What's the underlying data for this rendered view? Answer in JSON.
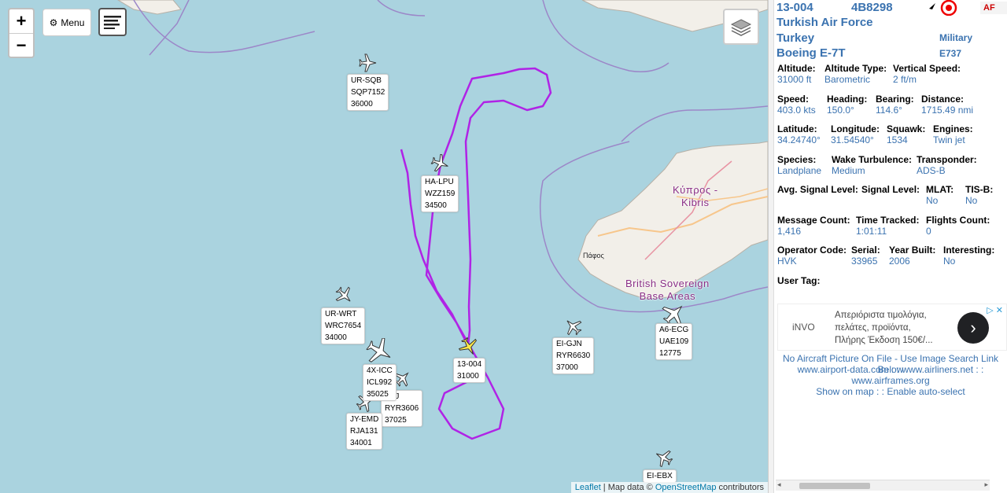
{
  "map": {
    "zoom_in": "+",
    "zoom_out": "−",
    "menu_label": "Menu",
    "land_labels": {
      "cyprus": "Κύπρος -\nKibris",
      "paphos": "Πάφος",
      "sovereign": "British Sovereign\nBase Areas"
    },
    "attribution": {
      "leaflet": "Leaflet",
      "sep": " | Map data © ",
      "osm": "OpenStreetMap",
      "tail": " contributors"
    },
    "aircraft": [
      {
        "name": "aircraft-ur-sqb",
        "label": "UR-SQB\nSQP7152\n36000"
      },
      {
        "name": "aircraft-ha-lpu",
        "label": "HA-LPU\nWZZ159\n34500"
      },
      {
        "name": "aircraft-ur-wrt",
        "label": "UR-WRT\nWRC7654\n34000"
      },
      {
        "name": "aircraft-4x-icc",
        "label": "4X-ICC\nICL992\n35025"
      },
      {
        "name": "aircraft-ssj",
        "label": "SSJ\nRYR3606\n37025"
      },
      {
        "name": "aircraft-jy-emd",
        "label": "JY-EMD\nRJA131\n34001"
      },
      {
        "name": "aircraft-13-004",
        "label": "13-004\n31000"
      },
      {
        "name": "aircraft-ei-gjn",
        "label": "EI-GJN\nRYR6630\n37000"
      },
      {
        "name": "aircraft-a6-ecg",
        "label": "A6-ECG\nUAE109\n12775"
      },
      {
        "name": "aircraft-ei-ebx",
        "label": "EI-EBX"
      }
    ]
  },
  "panel": {
    "callsign": "13-004",
    "icao": "4B8298",
    "flag_code": "AF",
    "operator": "Turkish Air Force",
    "country": "Turkey",
    "category": "Military",
    "type_name": "Boeing E-7T",
    "type_code": "E737",
    "fields": [
      {
        "label": "Altitude:",
        "value": "31000 ft"
      },
      {
        "label": "Altitude Type:",
        "value": "Barometric"
      },
      {
        "label": "Vertical Speed:",
        "value": "2 ft/m"
      },
      {
        "label": "Speed:",
        "value": "403.0 kts"
      },
      {
        "label": "Heading:",
        "value": "150.0°"
      },
      {
        "label": "Bearing:",
        "value": "114.6°"
      },
      {
        "label": "Distance:",
        "value": "1715.49 nmi"
      },
      {
        "label": "Latitude:",
        "value": "34.24740°"
      },
      {
        "label": "Longitude:",
        "value": "31.54540°"
      },
      {
        "label": "Squawk:",
        "value": "1534"
      },
      {
        "label": "Engines:",
        "value": "Twin jet"
      },
      {
        "label": "Species:",
        "value": "Landplane"
      },
      {
        "label": "Wake Turbulence:",
        "value": "Medium"
      },
      {
        "label": "Transponder:",
        "value": "ADS-B"
      },
      {
        "label": "Avg. Signal Level:",
        "value": ""
      },
      {
        "label": "Signal Level:",
        "value": ""
      },
      {
        "label": "MLAT:",
        "value": "No"
      },
      {
        "label": "TIS-B:",
        "value": "No"
      },
      {
        "label": "Message Count:",
        "value": "1,416"
      },
      {
        "label": "Time Tracked:",
        "value": "1:01:11"
      },
      {
        "label": "Flights Count:",
        "value": "0"
      },
      {
        "label": "Operator Code:",
        "value": "HVK"
      },
      {
        "label": "Serial:",
        "value": "33965"
      },
      {
        "label": "Year Built:",
        "value": "2006"
      },
      {
        "label": "Interesting:",
        "value": "No"
      },
      {
        "label": "User Tag:",
        "value": ""
      }
    ],
    "ad": {
      "brand": "iNVO",
      "text": "Απεριόριστα τιμολόγια,\nπελάτες, προϊόντα,\nΠλήρης Έκδοση 150€/...",
      "choices_icon": "▷",
      "close_icon": "✕"
    },
    "links": {
      "no_picture": "No Aircraft Picture On File - Use Image Search Link Below",
      "airport_data": "www.airport-data.com",
      "airliners": "www.airliners.net",
      "airframes": "www.airframes.org",
      "show_on_map": "Show on map",
      "auto_select": "Enable auto-select",
      "sep": " : : "
    }
  }
}
